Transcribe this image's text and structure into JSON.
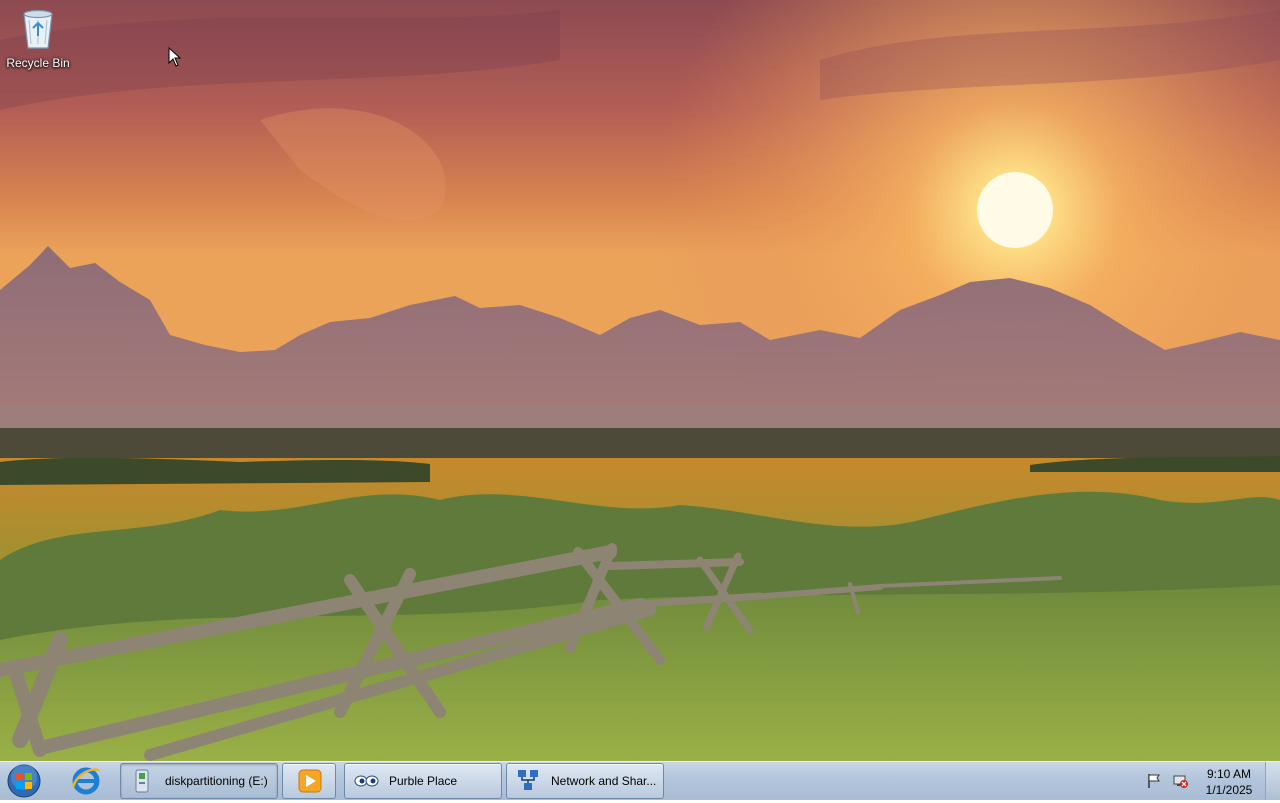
{
  "desktop": {
    "icons": [
      {
        "label": "Recycle Bin",
        "icon": "recycle-bin-icon"
      }
    ]
  },
  "taskbar": {
    "start_icon": "windows-start-orb-icon",
    "quick_launch": [
      {
        "icon": "internet-explorer-icon"
      },
      {
        "icon": "media-player-icon"
      }
    ],
    "tasks": [
      {
        "label": "diskpartitioning (E:)",
        "icon": "drive-icon",
        "active": true
      },
      {
        "label": "Purble Place",
        "icon": "purble-place-icon",
        "active": false
      },
      {
        "label": "Network and Shar...",
        "icon": "network-icon",
        "active": false
      }
    ],
    "tray": {
      "icons": [
        "action-center-flag-icon",
        "network-disconnected-icon"
      ],
      "time": "9:10 AM",
      "date": "1/1/2025"
    }
  },
  "colors": {
    "taskbar": "#b4c6dc",
    "sky_top": "#8a4a4a",
    "sun": "#fff3c0"
  }
}
